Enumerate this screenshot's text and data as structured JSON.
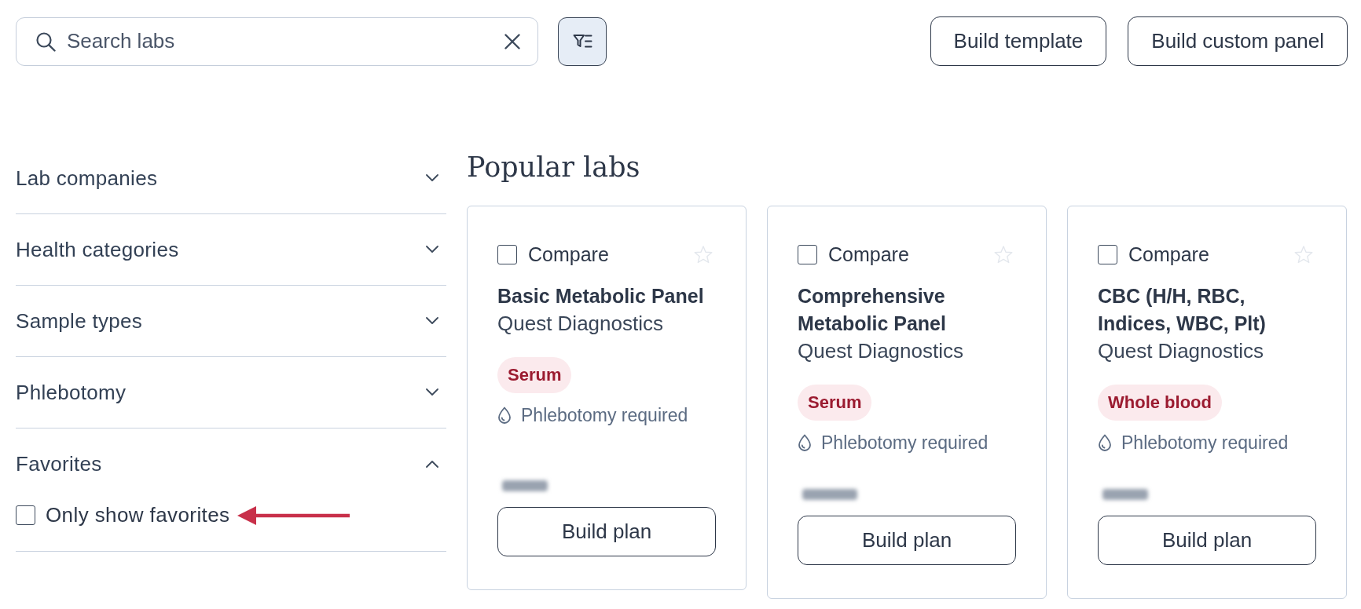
{
  "search": {
    "placeholder": "Search labs"
  },
  "actions": [
    {
      "label": "Build template"
    },
    {
      "label": "Build custom panel"
    }
  ],
  "filters": [
    {
      "label": "Lab companies",
      "expanded": false
    },
    {
      "label": "Health categories",
      "expanded": false
    },
    {
      "label": "Sample types",
      "expanded": false
    },
    {
      "label": "Phlebotomy",
      "expanded": false
    },
    {
      "label": "Favorites",
      "expanded": true,
      "options": [
        {
          "label": "Only show favorites",
          "checked": false,
          "highlighted": true
        }
      ]
    }
  ],
  "section_title": "Popular labs",
  "labs": [
    {
      "compare": {
        "label": "Compare",
        "checked": false
      },
      "favorite": false,
      "name": "Basic Metabolic Panel",
      "provider": "Quest Diagnostics",
      "sample_type": "Serum",
      "requirement": "Phlebotomy required",
      "button": "Build plan"
    },
    {
      "compare": {
        "label": "Compare",
        "checked": false
      },
      "favorite": false,
      "name": "Comprehensive Metabolic Panel",
      "provider": "Quest Diagnostics",
      "sample_type": "Serum",
      "requirement": "Phlebotomy required",
      "button": "Build plan"
    },
    {
      "compare": {
        "label": "Compare",
        "checked": false
      },
      "favorite": false,
      "name": "CBC (H/H, RBC, Indices, WBC, Plt)",
      "provider": "Quest Diagnostics",
      "sample_type": "Whole blood",
      "requirement": "Phlebotomy required",
      "button": "Build plan"
    }
  ]
}
